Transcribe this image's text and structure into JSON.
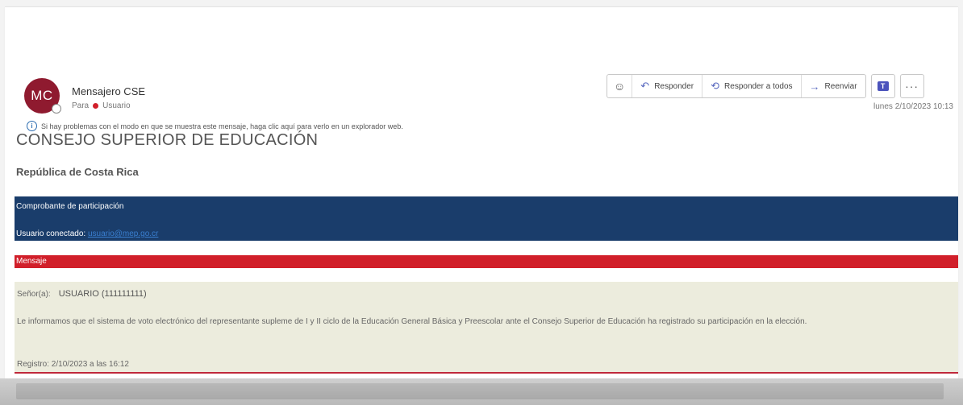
{
  "header": {
    "avatar_initials": "MC",
    "sender_name": "Mensajero CSE",
    "recipient_prefix": "Para",
    "recipient_name": "Usuario",
    "info_message": "Si hay problemas con el modo en que se muestra este mensaje, haga clic aquí para verlo en un explorador web.",
    "date": "lunes 2/10/2023 10:13"
  },
  "actions": {
    "emoji_icon": "emoji-icon",
    "reply_label": "Responder",
    "reply_all_label": "Responder a todos",
    "forward_label": "Reenviar",
    "teams_icon": "teams-icon",
    "more_icon": "more-icon"
  },
  "body": {
    "org_title": "CONSEJO SUPERIOR DE EDUCACIÓN",
    "subtitle": "República de Costa Rica",
    "banner_title": "Comprobante de participación",
    "connected_user_label": "Usuario conectado:",
    "connected_user_value": "usuario@mep.go.cr",
    "section_label": "Mensaje",
    "greeting_label": "Señor(a):",
    "greeting_name": "USUARIO (111111111)",
    "message_text": "Le informamos que el sistema de voto electrónico del representante supleme de I y II ciclo de la Educación General Básica y Preescolar ante el Consejo Superior de Educación ha registrado su participación en la elección.",
    "registro": "Registro: 2/10/2023 a las 16:12"
  },
  "colors": {
    "avatar": "#8f1a2f",
    "banner_blue": "#1a3d6b",
    "accent_red": "#d11f2a",
    "message_bg": "#ececdd"
  }
}
